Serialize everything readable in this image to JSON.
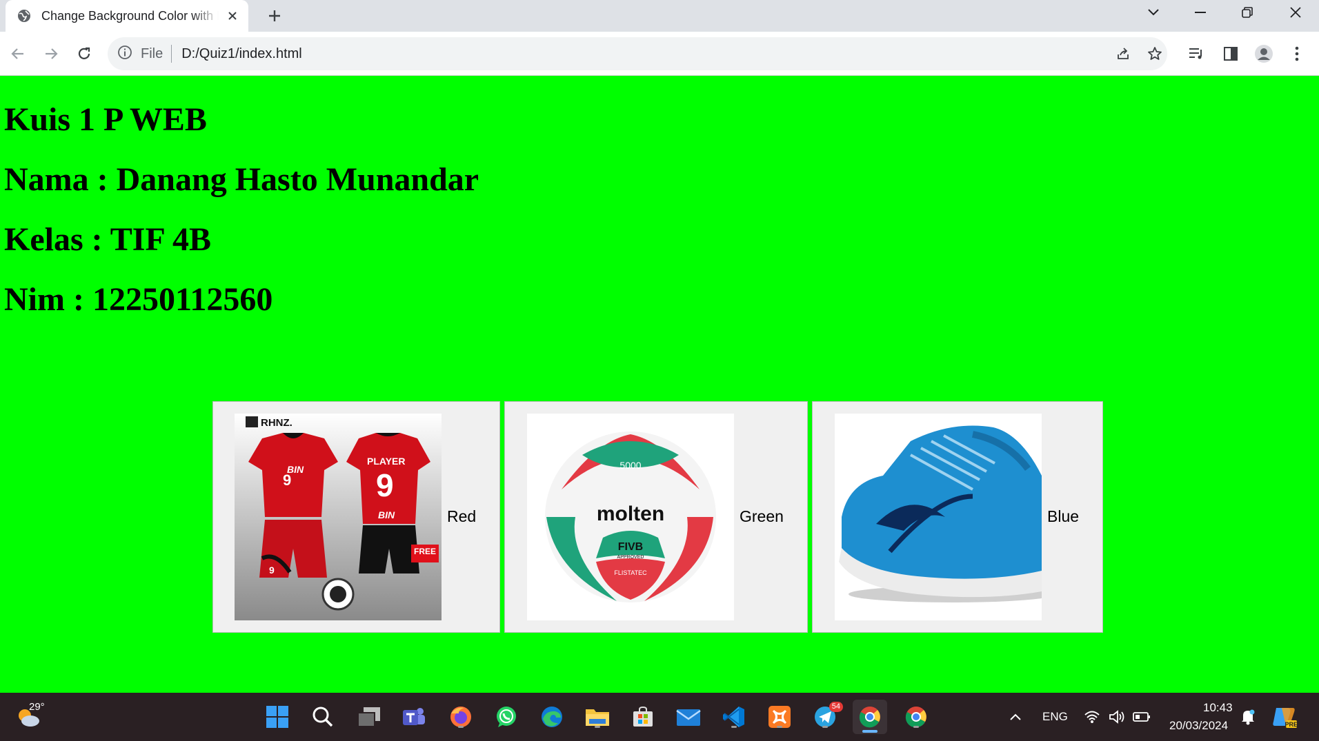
{
  "browser": {
    "tab_title": "Change Background Color with Buttons",
    "omnibox": {
      "scheme_label": "File",
      "url": "D:/Quiz1/index.html"
    }
  },
  "page": {
    "headings": [
      "Kuis 1 P WEB",
      "Nama : Danang Hasto Munandar",
      "Kelas : TIF 4B",
      "Nim : 12250112560"
    ],
    "cards": [
      {
        "label": "Red",
        "image": "red volleyball jersey",
        "color": "#ff0000"
      },
      {
        "label": "Green",
        "image": "molten volleyball",
        "color": "#00ff00"
      },
      {
        "label": "Blue",
        "image": "blue volleyball shoe",
        "color": "#0000ff"
      }
    ],
    "jersey": {
      "brand": "RHNZ.",
      "player": "PLAYER",
      "number": "9",
      "team": "BIN",
      "badge": "FREE"
    },
    "ball": {
      "brand": "molten",
      "model": "5000",
      "certification": "FIVB",
      "approved": "APPROVED",
      "tech": "FLISTATEC"
    }
  },
  "taskbar": {
    "weather_temp": "29°",
    "telegram_badge": "54",
    "lang": "ENG",
    "time": "10:43",
    "date": "20/03/2024",
    "copilot_badge": "PRE"
  },
  "colors": {
    "page_bg": "#00ff00",
    "taskbar_bg": "#2a2023",
    "card_bg": "#f0f0f0"
  }
}
